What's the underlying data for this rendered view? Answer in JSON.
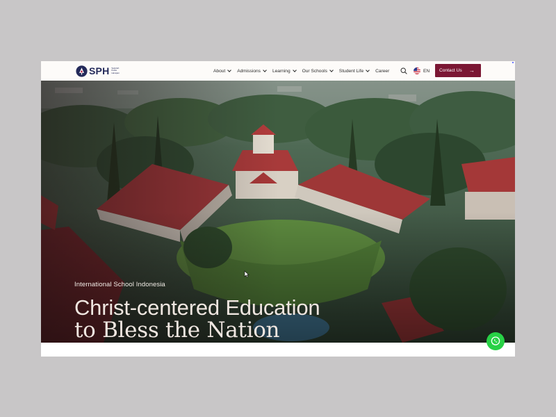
{
  "brand": {
    "name": "SPH",
    "subtitle": "Sekolah Pelita Harapan"
  },
  "nav": {
    "items": [
      {
        "label": "About",
        "dropdown": true
      },
      {
        "label": "Admissions",
        "dropdown": true
      },
      {
        "label": "Learning",
        "dropdown": true
      },
      {
        "label": "Our Schools",
        "dropdown": true
      },
      {
        "label": "Student Life",
        "dropdown": true
      },
      {
        "label": "Career",
        "dropdown": false
      }
    ],
    "search_icon": "search-icon",
    "language": "EN",
    "language_flag": "us-flag-icon",
    "contact_label": "Contact Us",
    "contact_icon": "arrow-right-icon"
  },
  "hero": {
    "tagline": "International School Indonesia",
    "title_line1": "Christ-centered Education",
    "title_line2": "to Bless the Nation"
  },
  "colors": {
    "accent": "#7b1734",
    "brand_navy": "#242a5a",
    "whatsapp": "#28d146",
    "page_bg": "#c8c6c7"
  },
  "floating": {
    "whatsapp_icon": "whatsapp-icon"
  }
}
